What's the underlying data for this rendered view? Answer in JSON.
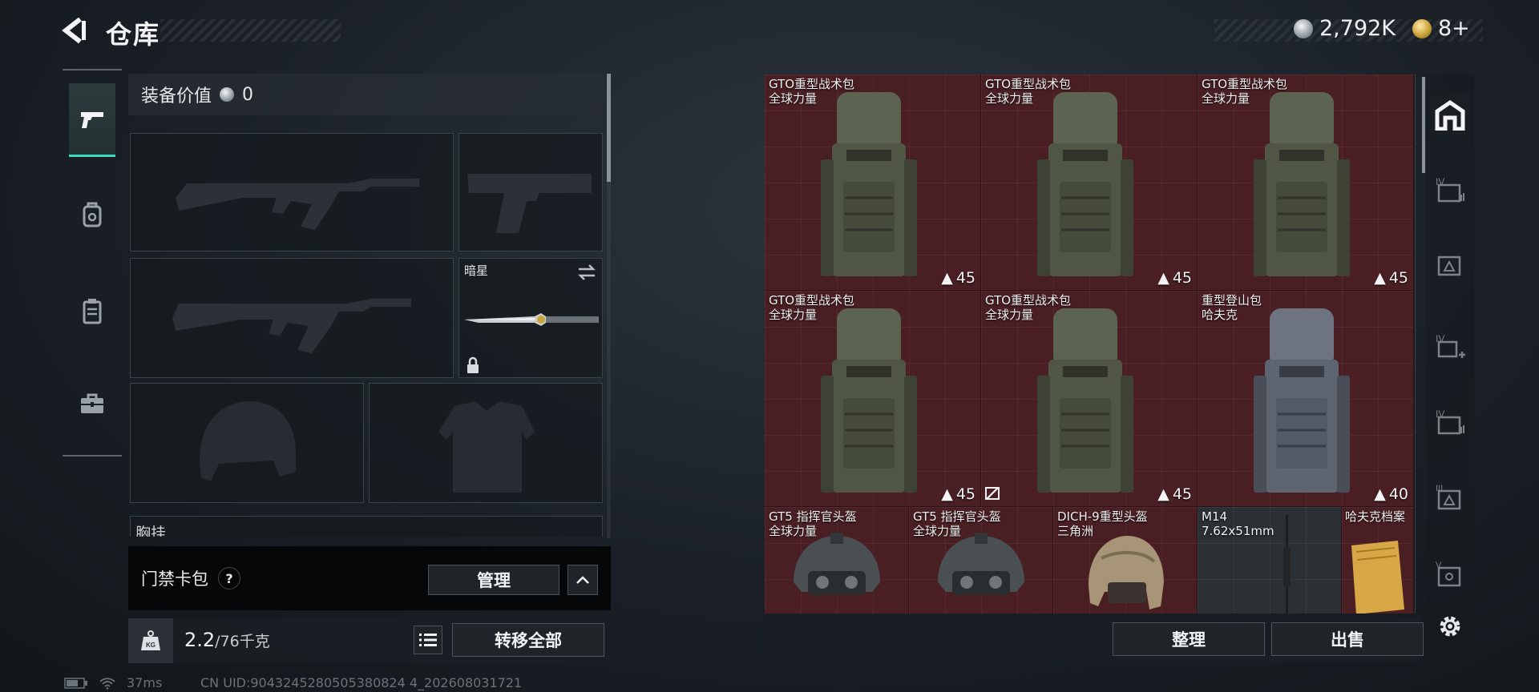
{
  "header": {
    "title": "仓库"
  },
  "currency": [
    {
      "type": "silver",
      "amount": "2,792K"
    },
    {
      "type": "gold",
      "amount": "8+"
    }
  ],
  "left_tabs": [
    {
      "icon": "pistol-icon",
      "active": true
    },
    {
      "icon": "backpack-icon",
      "active": false
    },
    {
      "icon": "clipboard-icon",
      "active": false
    },
    {
      "icon": "briefcase-icon",
      "active": false
    }
  ],
  "loadout": {
    "equip_value_label": "装备价值",
    "equip_value": "0",
    "melee_name": "暗星",
    "chest_rig_label": "胸挂"
  },
  "access_card": {
    "title": "门禁卡包",
    "help": "?",
    "manage_label": "管理"
  },
  "inventory": {
    "weight_current": "2.2",
    "weight_max": "/76千克",
    "kg_badge": "KG",
    "transfer_all_label": "转移全部"
  },
  "storage_items": [
    {
      "name": "GTO重型战术包",
      "brand": "全球力量",
      "capacity": "45"
    },
    {
      "name": "GTO重型战术包",
      "brand": "全球力量",
      "capacity": "45"
    },
    {
      "name": "GTO重型战术包",
      "brand": "全球力量",
      "capacity": "45"
    },
    {
      "name": "GTO重型战术包",
      "brand": "全球力量",
      "capacity": "45"
    },
    {
      "name": "GTO重型战术包",
      "brand": "全球力量",
      "capacity": "45"
    },
    {
      "name": "重型登山包",
      "brand": "哈夫克",
      "capacity": "40"
    },
    {
      "name": "GT5 指挥官头盔",
      "brand": "全球力量"
    },
    {
      "name": "GT5 指挥官头盔",
      "brand": "全球力量"
    },
    {
      "name": "DICH-9重型头盔",
      "brand": "三角洲"
    },
    {
      "name": "M14",
      "brand": "7.62x51mm"
    },
    {
      "name": "哈夫克档案",
      "brand": ""
    }
  ],
  "actions": {
    "sort_label": "整理",
    "sell_label": "出售"
  },
  "categories": [
    {
      "icon": "all-items-icon",
      "active": true
    },
    {
      "icon": "iv-storage-icon",
      "active": false
    },
    {
      "icon": "triangle-storage-icon",
      "active": false
    },
    {
      "icon": "iv-plus-icon",
      "active": false
    },
    {
      "icon": "iv-storage-2-icon",
      "active": false
    },
    {
      "icon": "iii-triangle-icon",
      "active": false
    },
    {
      "icon": "v-storage-icon",
      "active": false
    },
    {
      "icon": "gear-icon",
      "active": false
    }
  ],
  "status": {
    "ping": "37ms",
    "uid": "CN UID:9043245280505380824 4_202608031721"
  },
  "colors": {
    "accent": "#3ad9c2",
    "item_bg": "#4a1f24"
  }
}
